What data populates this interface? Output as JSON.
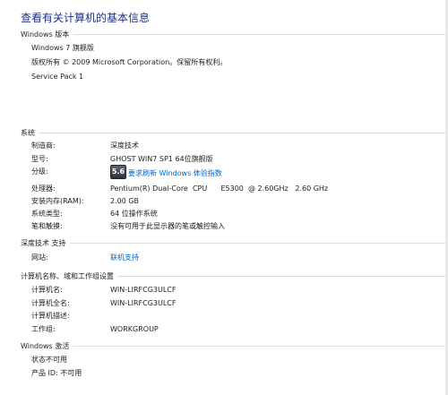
{
  "page": {
    "title": "查看有关计算机的基本信息"
  },
  "windows_edition": {
    "heading": "Windows 版本",
    "edition": "Windows 7 旗舰版",
    "copyright": "版权所有 © 2009 Microsoft Corporation。保留所有权利。",
    "service_pack": "Service Pack 1"
  },
  "system": {
    "heading": "系统",
    "rows": [
      {
        "label": "制造商:",
        "value": "深度技术"
      },
      {
        "label": "型号:",
        "value": "GHOST WIN7 SP1 64位旗舰版"
      },
      {
        "label": "分级:",
        "value": "要求刷新 Windows 体验指数",
        "badge": "5.6"
      },
      {
        "label": "处理器:",
        "value": "Pentium(R) Dual-Core  CPU      E5300  @ 2.60GHz   2.60 GHz"
      },
      {
        "label": "安装内存(RAM):",
        "value": "2.00 GB"
      },
      {
        "label": "系统类型:",
        "value": "64 位操作系统"
      },
      {
        "label": "笔和触摸:",
        "value": "没有可用于此显示器的笔或触控输入"
      }
    ]
  },
  "support": {
    "heading": "深度技术 支持",
    "rows": [
      {
        "label": "网站:",
        "value": "联机支持"
      }
    ]
  },
  "computer_name": {
    "heading": "计算机名称、域和工作组设置",
    "rows": [
      {
        "label": "计算机名:",
        "value": "WIN-LIRFCG3ULCF"
      },
      {
        "label": "计算机全名:",
        "value": "WIN-LIRFCG3ULCF"
      },
      {
        "label": "计算机描述:",
        "value": ""
      },
      {
        "label": "工作组:",
        "value": "WORKGROUP"
      }
    ]
  },
  "activation": {
    "heading": "Windows 激活",
    "status": "状态不可用",
    "product_id": "产品 ID: 不可用"
  },
  "colors": {
    "title": "#1e3287",
    "link": "#0066cc",
    "divider": "#d5dfe5"
  }
}
